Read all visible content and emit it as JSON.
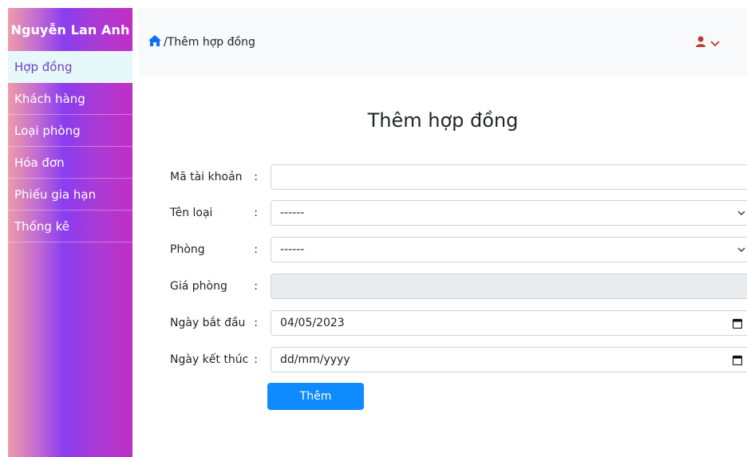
{
  "sidebar": {
    "brand": "Nguyễn Lan Anh",
    "items": [
      {
        "label": "Hợp đồng",
        "active": true
      },
      {
        "label": "Khách hàng"
      },
      {
        "label": "Loại phòng"
      },
      {
        "label": "Hóa đơn"
      },
      {
        "label": "Phiếu gia hạn"
      },
      {
        "label": "Thống kê"
      }
    ]
  },
  "header": {
    "breadcrumb": "/Thêm hợp đồng",
    "home_icon": "home-icon",
    "user_icon": "user-icon",
    "accent": "#c0392b"
  },
  "form": {
    "title": "Thêm hợp đồng",
    "fields": [
      {
        "label": "Mã tài khoản",
        "colon": ":",
        "value": ""
      },
      {
        "label": "Tên loại",
        "colon": ":",
        "value": "------"
      },
      {
        "label": "Phòng",
        "colon": ":",
        "value": "------"
      },
      {
        "label": "Giá phòng",
        "colon": ":",
        "value": ""
      },
      {
        "label": "Ngày bắt đầu",
        "colon": ":",
        "value": "04/05/2023"
      },
      {
        "label": "Ngày kết thúc",
        "colon": ":",
        "value": "dd/mm/yyyy"
      }
    ],
    "submit_label": "Thêm",
    "button_color": "#0d8bff"
  }
}
